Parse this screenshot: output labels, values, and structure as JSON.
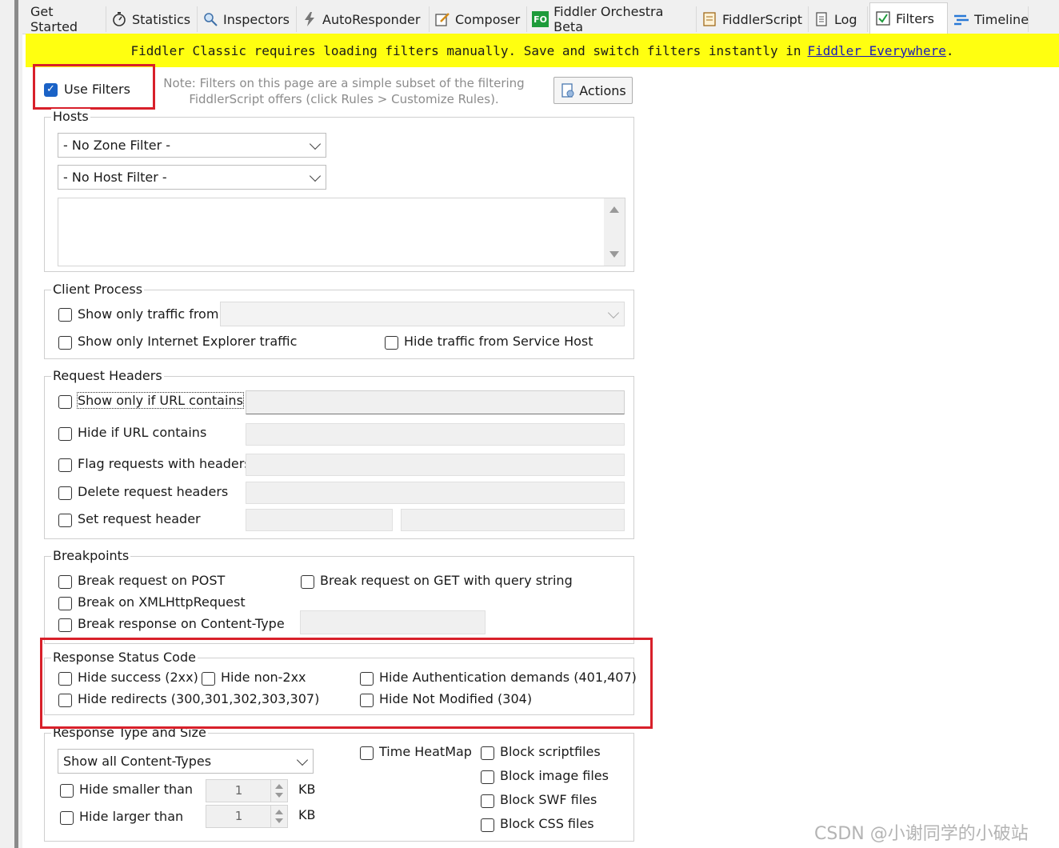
{
  "tabs": [
    {
      "label": "Get Started",
      "icon": "none"
    },
    {
      "label": "Statistics",
      "icon": "stopwatch-icon"
    },
    {
      "label": "Inspectors",
      "icon": "inspect-icon"
    },
    {
      "label": "AutoResponder",
      "icon": "lightning-icon"
    },
    {
      "label": "Composer",
      "icon": "compose-icon"
    },
    {
      "label": "Fiddler Orchestra Beta",
      "icon": "fo-icon",
      "icon_text": "FO"
    },
    {
      "label": "FiddlerScript",
      "icon": "script-icon"
    },
    {
      "label": "Log",
      "icon": "log-icon"
    },
    {
      "label": "Filters",
      "icon": "filter-check-icon",
      "active": true
    },
    {
      "label": "Timeline",
      "icon": "timeline-icon"
    }
  ],
  "banner": {
    "text": "Fiddler Classic requires loading filters manually. Save and switch filters instantly in",
    "link": "Fiddler Everywhere",
    "suffix": ".",
    "bg_color": "#ffff10"
  },
  "use_filters": {
    "label": "Use Filters",
    "checked": true
  },
  "note": {
    "line1": "Note: Filters on this page are a simple subset of the filtering",
    "line2": "FiddlerScript offers (click Rules > Customize Rules)."
  },
  "actions_button": "Actions",
  "hosts": {
    "title": "Hosts",
    "zone_filter": "- No Zone Filter -",
    "host_filter": "- No Host Filter -"
  },
  "client_process": {
    "title": "Client Process",
    "show_only_traffic_from": "Show only traffic from",
    "show_only_ie": "Show only Internet Explorer traffic",
    "hide_service_host": "Hide traffic from Service Host"
  },
  "request_headers": {
    "title": "Request Headers",
    "show_only_url": "Show only if URL contains",
    "hide_url": "Hide if URL contains",
    "flag_requests": "Flag requests with headers",
    "delete_headers": "Delete request headers",
    "set_header": "Set request header"
  },
  "breakpoints": {
    "title": "Breakpoints",
    "break_post": "Break request on POST",
    "break_get": "Break request on GET with query string",
    "break_xhr": "Break on XMLHttpRequest",
    "break_content_type": "Break response on Content-Type"
  },
  "response_status": {
    "title": "Response Status Code",
    "hide_success": "Hide success (2xx)",
    "hide_non2xx": "Hide non-2xx",
    "hide_auth": "Hide Authentication demands (401,407)",
    "hide_redirects": "Hide redirects (300,301,302,303,307)",
    "hide_not_modified": "Hide Not Modified (304)"
  },
  "response_type": {
    "title": "Response Type and Size",
    "content_types": "Show all Content-Types",
    "time_heatmap": "Time HeatMap",
    "block_script": "Block scriptfiles",
    "block_image": "Block image files",
    "block_swf": "Block SWF files",
    "block_css": "Block CSS files",
    "hide_smaller": "Hide smaller than",
    "hide_larger": "Hide larger than",
    "smaller_value": "1",
    "larger_value": "1",
    "unit": "KB"
  },
  "watermark": "CSDN @小谢同学的小破站",
  "colors": {
    "highlight_red": "#d8202a",
    "checkbox_blue": "#1a62c6"
  }
}
